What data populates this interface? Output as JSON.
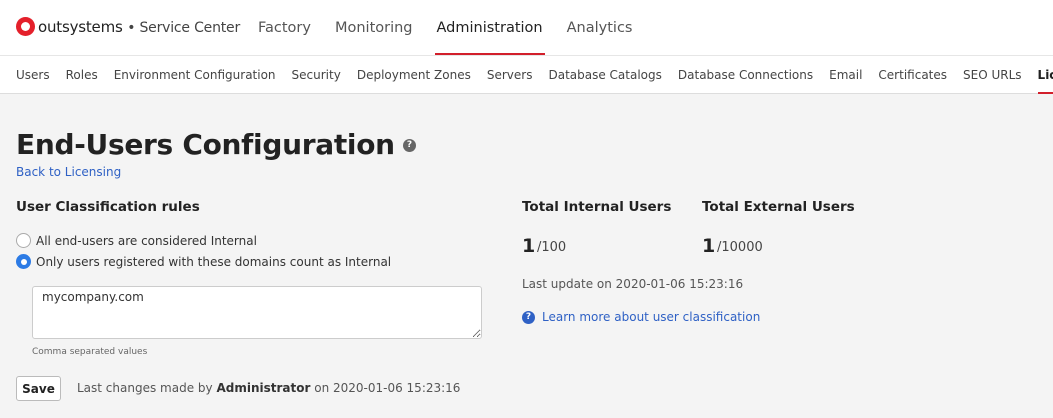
{
  "header": {
    "brand": "outsystems",
    "product": "• Service Center",
    "nav": [
      "Factory",
      "Monitoring",
      "Administration",
      "Analytics"
    ],
    "active_nav": "Administration"
  },
  "subnav": {
    "items": [
      "Users",
      "Roles",
      "Environment Configuration",
      "Security",
      "Deployment Zones",
      "Servers",
      "Database Catalogs",
      "Database Connections",
      "Email",
      "Certificates",
      "SEO URLs",
      "Licensing"
    ],
    "active": "Licensing"
  },
  "page": {
    "title": "End-Users Configuration",
    "help_icon": "?",
    "back_link": "Back to Licensing"
  },
  "classification": {
    "title": "User Classification rules",
    "option_all_internal": "All end-users are considered Internal",
    "option_domains": "Only users registered with these domains count as Internal",
    "selected": "option_domains",
    "domains_value": "mycompany.com",
    "hint": "Comma separated values",
    "save_label": "Save",
    "last_changes_prefix": "Last changes made by",
    "last_changes_user": "Administrator",
    "last_changes_suffix": "on 2020-01-06 15:23:16"
  },
  "stats": {
    "internal_label": "Total Internal Users",
    "internal_count": "1",
    "internal_limit": "/100",
    "external_label": "Total External Users",
    "external_count": "1",
    "external_limit": "/10000",
    "last_update": "Last update on 2020-01-06 15:23:16",
    "learn_more": "Learn more about user classification",
    "learn_icon": "?"
  },
  "colors": {
    "accent_red": "#d21f2b",
    "link_blue": "#2f61c5",
    "radio_blue": "#2c7be5"
  }
}
